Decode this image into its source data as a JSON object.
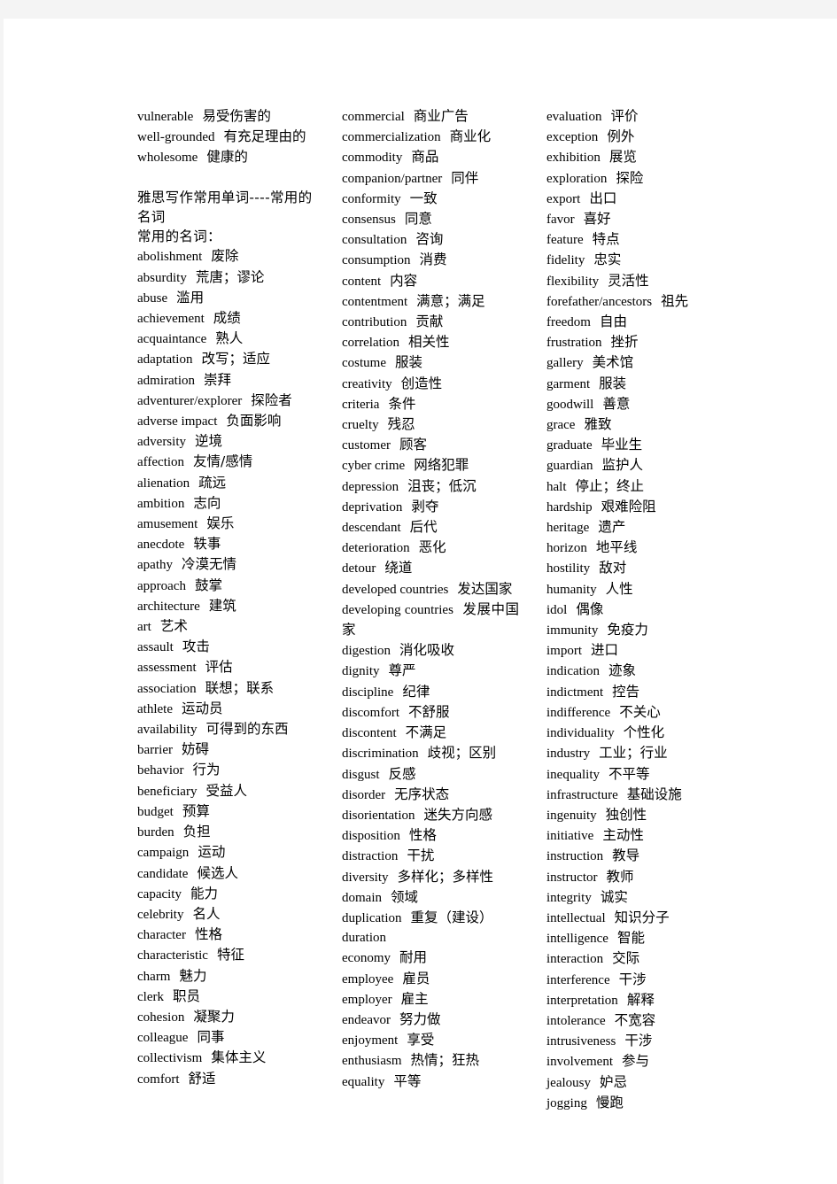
{
  "document": {
    "columns": [
      {
        "entries": [
          {
            "en": "vulnerable",
            "zh": "易受伤害的"
          },
          {
            "en": "well-grounded",
            "zh": "有充足理由的"
          },
          {
            "en": "wholesome",
            "zh": "健康的"
          }
        ],
        "section_heading": "雅思写作常用单词----常用的名词",
        "section_subheading": "常用的名词：",
        "section_entries": [
          {
            "en": "abolishment",
            "zh": "废除"
          },
          {
            "en": "absurdity",
            "zh": "荒唐；谬论"
          },
          {
            "en": "abuse",
            "zh": "滥用"
          },
          {
            "en": "achievement",
            "zh": "成绩"
          },
          {
            "en": "acquaintance",
            "zh": "熟人"
          },
          {
            "en": "adaptation",
            "zh": "改写；适应"
          },
          {
            "en": "admiration",
            "zh": "崇拜"
          },
          {
            "en": "adventurer/explorer",
            "zh": "探险者"
          },
          {
            "en": "adverse impact",
            "zh": "负面影响"
          },
          {
            "en": "adversity",
            "zh": "逆境"
          },
          {
            "en": "affection",
            "zh": "友情/感情"
          },
          {
            "en": "alienation",
            "zh": "疏远"
          },
          {
            "en": "ambition",
            "zh": "志向"
          },
          {
            "en": "amusement",
            "zh": "娱乐"
          },
          {
            "en": "anecdote",
            "zh": "轶事"
          },
          {
            "en": "apathy",
            "zh": "冷漠无情"
          },
          {
            "en": "approach",
            "zh": "鼓掌"
          },
          {
            "en": "architecture",
            "zh": "建筑"
          },
          {
            "en": "art",
            "zh": "艺术"
          },
          {
            "en": "assault",
            "zh": "攻击"
          },
          {
            "en": "assessment",
            "zh": "评估"
          },
          {
            "en": "association",
            "zh": "联想；联系"
          },
          {
            "en": "athlete",
            "zh": "运动员"
          },
          {
            "en": "availability",
            "zh": "可得到的东西"
          },
          {
            "en": "barrier",
            "zh": "妨碍"
          },
          {
            "en": "behavior",
            "zh": "行为"
          },
          {
            "en": "beneficiary",
            "zh": "受益人"
          },
          {
            "en": "budget",
            "zh": "预算"
          },
          {
            "en": "burden",
            "zh": "负担"
          },
          {
            "en": "campaign",
            "zh": "运动"
          },
          {
            "en": "candidate",
            "zh": "候选人"
          },
          {
            "en": "capacity",
            "zh": "能力"
          },
          {
            "en": "celebrity",
            "zh": "名人"
          },
          {
            "en": "character",
            "zh": "性格"
          },
          {
            "en": "characteristic",
            "zh": "特征"
          },
          {
            "en": "charm",
            "zh": "魅力"
          },
          {
            "en": "clerk",
            "zh": "职员"
          },
          {
            "en": "cohesion",
            "zh": "凝聚力"
          },
          {
            "en": "colleague",
            "zh": "同事"
          },
          {
            "en": "collectivism",
            "zh": "集体主义"
          },
          {
            "en": "comfort",
            "zh": "舒适"
          }
        ]
      },
      {
        "entries": [
          {
            "en": "commercial",
            "zh": "商业广告"
          },
          {
            "en": "commercialization",
            "zh": "商业化"
          },
          {
            "en": "commodity",
            "zh": "商品"
          },
          {
            "en": "companion/partner",
            "zh": "同伴"
          },
          {
            "en": "conformity",
            "zh": "一致"
          },
          {
            "en": "consensus",
            "zh": "同意"
          },
          {
            "en": "consultation",
            "zh": "咨询"
          },
          {
            "en": "consumption",
            "zh": "消费"
          },
          {
            "en": "content",
            "zh": "内容"
          },
          {
            "en": "contentment",
            "zh": "满意；满足"
          },
          {
            "en": "contribution",
            "zh": "贡献"
          },
          {
            "en": "correlation",
            "zh": "相关性"
          },
          {
            "en": "costume",
            "zh": "服装"
          },
          {
            "en": "creativity",
            "zh": "创造性"
          },
          {
            "en": "criteria",
            "zh": "条件"
          },
          {
            "en": "cruelty",
            "zh": "残忍"
          },
          {
            "en": "customer",
            "zh": "顾客"
          },
          {
            "en": "cyber crime",
            "zh": "网络犯罪"
          },
          {
            "en": "depression",
            "zh": "沮丧；低沉"
          },
          {
            "en": "deprivation",
            "zh": "剥夺"
          },
          {
            "en": "descendant",
            "zh": "后代"
          },
          {
            "en": "deterioration",
            "zh": "恶化"
          },
          {
            "en": "detour",
            "zh": "绕道"
          },
          {
            "en": "developed countries",
            "zh": "发达国家"
          },
          {
            "en": "developing countries",
            "zh": "发展中国家"
          },
          {
            "en": "digestion",
            "zh": "消化吸收"
          },
          {
            "en": "dignity",
            "zh": "尊严"
          },
          {
            "en": "discipline",
            "zh": "纪律"
          },
          {
            "en": "discomfort",
            "zh": "不舒服"
          },
          {
            "en": "discontent",
            "zh": "不满足"
          },
          {
            "en": "discrimination",
            "zh": "歧视；区别"
          },
          {
            "en": "disgust",
            "zh": "反感"
          },
          {
            "en": "disorder",
            "zh": "无序状态"
          },
          {
            "en": "disorientation",
            "zh": "迷失方向感"
          },
          {
            "en": "disposition",
            "zh": "性格"
          },
          {
            "en": "distraction",
            "zh": "干扰"
          },
          {
            "en": "diversity",
            "zh": "多样化；多样性"
          },
          {
            "en": "domain",
            "zh": "领域"
          },
          {
            "en": "duplication",
            "zh": "重复（建设）"
          },
          {
            "en": "duration",
            "zh": ""
          },
          {
            "en": "economy",
            "zh": "耐用"
          },
          {
            "en": "employee",
            "zh": "雇员"
          },
          {
            "en": "employer",
            "zh": "雇主"
          },
          {
            "en": "endeavor",
            "zh": "努力做"
          },
          {
            "en": "enjoyment",
            "zh": "享受"
          },
          {
            "en": "enthusiasm",
            "zh": "热情；狂热"
          },
          {
            "en": "equality",
            "zh": "平等"
          }
        ]
      },
      {
        "entries": [
          {
            "en": "evaluation",
            "zh": "评价"
          },
          {
            "en": "exception",
            "zh": "例外"
          },
          {
            "en": "exhibition",
            "zh": "展览"
          },
          {
            "en": "exploration",
            "zh": "探险"
          },
          {
            "en": "export",
            "zh": "出口"
          },
          {
            "en": "favor",
            "zh": "喜好"
          },
          {
            "en": "feature",
            "zh": "特点"
          },
          {
            "en": "fidelity",
            "zh": "忠实"
          },
          {
            "en": "flexibility",
            "zh": "灵活性"
          },
          {
            "en": "forefather/ancestors",
            "zh": "祖先"
          },
          {
            "en": "freedom",
            "zh": "自由"
          },
          {
            "en": "frustration",
            "zh": "挫折"
          },
          {
            "en": "gallery",
            "zh": "美术馆"
          },
          {
            "en": "garment",
            "zh": "服装"
          },
          {
            "en": "goodwill",
            "zh": "善意"
          },
          {
            "en": "grace",
            "zh": "雅致"
          },
          {
            "en": "graduate",
            "zh": "毕业生"
          },
          {
            "en": "guardian",
            "zh": "监护人"
          },
          {
            "en": "halt",
            "zh": "停止；终止"
          },
          {
            "en": "hardship",
            "zh": "艰难险阻"
          },
          {
            "en": "heritage",
            "zh": "遗产"
          },
          {
            "en": "horizon",
            "zh": "地平线"
          },
          {
            "en": "hostility",
            "zh": "敌对"
          },
          {
            "en": "humanity",
            "zh": "人性"
          },
          {
            "en": "idol",
            "zh": "偶像"
          },
          {
            "en": "immunity",
            "zh": "免疫力"
          },
          {
            "en": "import",
            "zh": "进口"
          },
          {
            "en": "indication",
            "zh": "迹象"
          },
          {
            "en": "indictment",
            "zh": "控告"
          },
          {
            "en": "indifference",
            "zh": "不关心"
          },
          {
            "en": "individuality",
            "zh": "个性化"
          },
          {
            "en": "industry",
            "zh": "工业；行业"
          },
          {
            "en": "inequality",
            "zh": "不平等"
          },
          {
            "en": "infrastructure",
            "zh": "基础设施"
          },
          {
            "en": "ingenuity",
            "zh": "独创性"
          },
          {
            "en": "initiative",
            "zh": "主动性"
          },
          {
            "en": "instruction",
            "zh": "教导"
          },
          {
            "en": "instructor",
            "zh": "教师"
          },
          {
            "en": "integrity",
            "zh": "诚实"
          },
          {
            "en": "intellectual",
            "zh": "知识分子"
          },
          {
            "en": "intelligence",
            "zh": "智能"
          },
          {
            "en": "interaction",
            "zh": "交际"
          },
          {
            "en": "interference",
            "zh": "干涉"
          },
          {
            "en": "interpretation",
            "zh": "解释"
          },
          {
            "en": "intolerance",
            "zh": "不宽容"
          },
          {
            "en": "intrusiveness",
            "zh": "干涉"
          },
          {
            "en": "involvement",
            "zh": "参与"
          },
          {
            "en": "jealousy",
            "zh": "妒忌"
          },
          {
            "en": "jogging",
            "zh": "慢跑"
          }
        ]
      }
    ]
  }
}
